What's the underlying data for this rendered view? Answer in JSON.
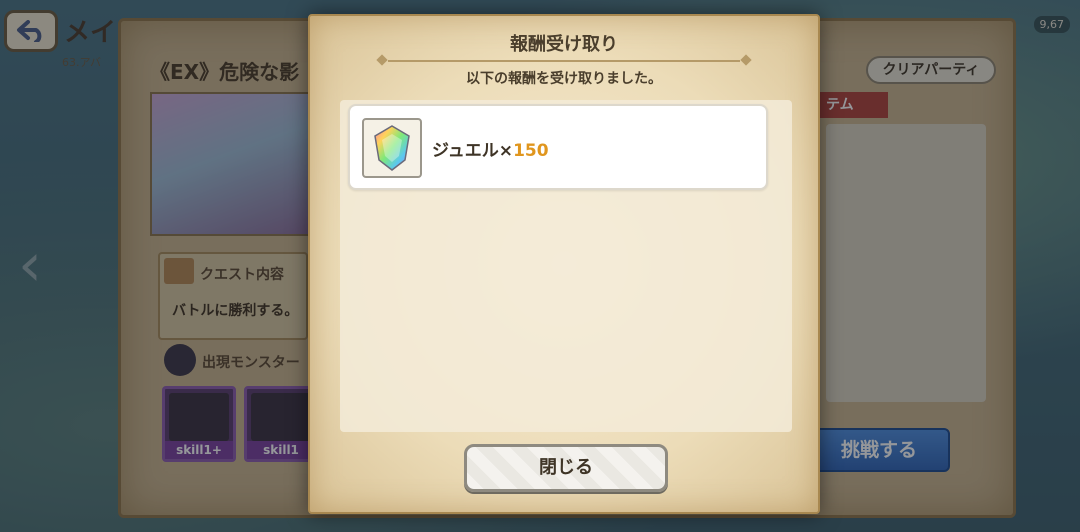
{
  "header": {
    "back_icon": "back-arrow-icon",
    "title": "メイ",
    "subtitle": "63.アバ",
    "top_right_value": "9,67"
  },
  "quest": {
    "title": "《EX》危険な影",
    "content_label": "クエスト内容",
    "description": "バトルに勝利する。",
    "monster_label": "出現モンスター",
    "monsters": [
      {
        "skill": "skill1+"
      },
      {
        "skill": "skill1"
      }
    ],
    "clear_party_label": "クリアパーティ",
    "item_ribbon_label": "テム",
    "challenge_label": "挑戦する"
  },
  "modal": {
    "title": "報酬受け取り",
    "message": "以下の報酬を受け取りました。",
    "rewards": [
      {
        "name": "ジュエル×",
        "count": "150",
        "icon": "rainbow-jewel-icon"
      }
    ],
    "close_label": "閉じる"
  },
  "colors": {
    "parchment": "#ecdcb8",
    "count_orange": "#e0961e",
    "challenge_blue": "#2f64b8"
  }
}
